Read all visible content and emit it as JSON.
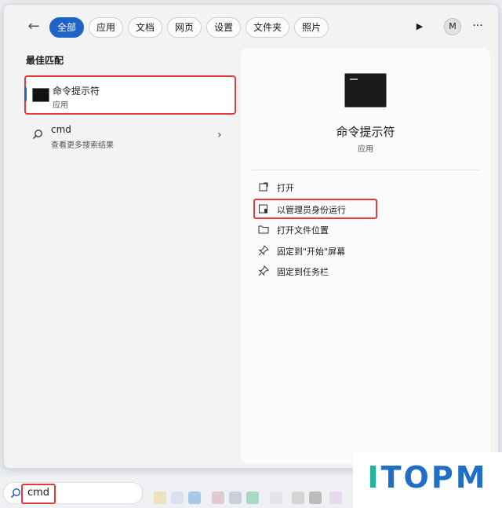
{
  "tabs": [
    {
      "label": "全部",
      "active": true
    },
    {
      "label": "应用"
    },
    {
      "label": "文档"
    },
    {
      "label": "网页"
    },
    {
      "label": "设置"
    },
    {
      "label": "文件夹"
    },
    {
      "label": "照片"
    }
  ],
  "user_initial": "M",
  "section_title": "最佳匹配",
  "best_match": {
    "name": "命令提示符",
    "type": "应用"
  },
  "web_search": {
    "query": "cmd",
    "subtitle": "查看更多搜索结果"
  },
  "preview": {
    "title": "命令提示符",
    "type": "应用",
    "actions": [
      {
        "label": "打开",
        "icon": "open-icon"
      },
      {
        "label": "以管理员身份运行",
        "icon": "admin-shield-icon"
      },
      {
        "label": "打开文件位置",
        "icon": "folder-icon"
      },
      {
        "label": "固定到\"开始\"屏幕",
        "icon": "pin-icon"
      },
      {
        "label": "固定到任务栏",
        "icon": "pin-icon"
      }
    ]
  },
  "taskbar": {
    "search_value": "cmd"
  },
  "watermark": {
    "text": "ITOPM",
    "colors": {
      "I": "#22b59b",
      "rest": "#1f6fc4"
    }
  },
  "colors": {
    "accent": "#1f63c6",
    "highlight_border": "#e33b3b"
  }
}
